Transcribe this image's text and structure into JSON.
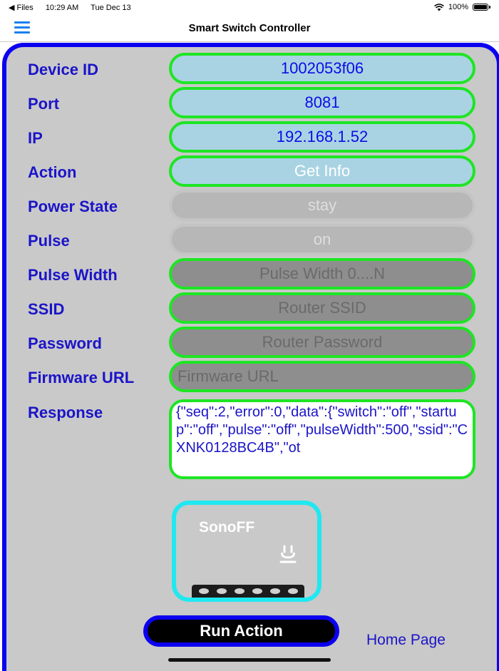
{
  "status_bar": {
    "back_label": "◀ Files",
    "time": "10:29 AM",
    "date": "Tue Dec 13",
    "battery": "100%"
  },
  "nav": {
    "title": "Smart Switch Controller"
  },
  "form": {
    "device_id": {
      "label": "Device ID",
      "value": "1002053f06"
    },
    "port": {
      "label": "Port",
      "value": "8081"
    },
    "ip": {
      "label": "IP",
      "value": "192.168.1.52"
    },
    "action": {
      "label": "Action",
      "value": "Get Info"
    },
    "power_state": {
      "label": "Power State",
      "value": "stay"
    },
    "pulse": {
      "label": "Pulse",
      "value": "on"
    },
    "pulse_width": {
      "label": "Pulse Width",
      "placeholder": "Pulse Width 0....N"
    },
    "ssid": {
      "label": "SSID",
      "placeholder": "Router SSID"
    },
    "password": {
      "label": "Password",
      "placeholder": "Router Password"
    },
    "firmware_url": {
      "label": "Firmware URL",
      "placeholder": "Firmware URL"
    },
    "response": {
      "label": "Response",
      "value": "{\"seq\":2,\"error\":0,\"data\":{\"switch\":\"off\",\"startup\":\"off\",\"pulse\":\"off\",\"pulseWidth\":500,\"ssid\":\"CXNK0128BC4B\",\"ot"
    }
  },
  "device_card": {
    "name": "SonoFF",
    "icon": "power-plug-icon"
  },
  "buttons": {
    "run_action": "Run Action",
    "home_page": "Home Page"
  },
  "colors": {
    "accent_blue": "#0c00f0",
    "field_border": "#1ee524",
    "field_bg": "#a9d3e3",
    "card_border": "#20e8f0"
  }
}
